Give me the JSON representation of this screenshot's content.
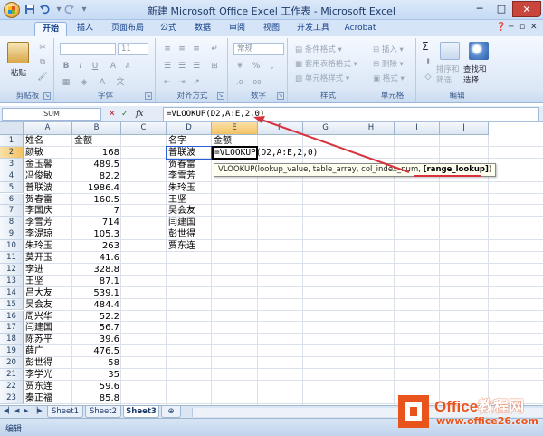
{
  "colors": {
    "accent": "#15428b",
    "selection": "#f3c363",
    "annotation": "#d9323e",
    "watermark": "#e8541c"
  },
  "window": {
    "title": "新建 Microsoft Office Excel 工作表 - Microsoft Excel",
    "controls": {
      "minimize": "─",
      "maximize": "□",
      "close": "✕"
    },
    "qat": {
      "save_icon": "save-icon",
      "undo_icon": "undo-icon",
      "redo_icon": "redo-icon"
    }
  },
  "ribbon": {
    "tabs": [
      "开始",
      "插入",
      "页面布局",
      "公式",
      "数据",
      "审阅",
      "视图",
      "开发工具",
      "Acrobat"
    ],
    "active_tab": "开始",
    "groups": {
      "clipboard": {
        "label": "剪贴板",
        "paste": "粘贴"
      },
      "font": {
        "label": "字体",
        "size": "11",
        "bold": "B",
        "italic": "I",
        "underline": "U"
      },
      "alignment": {
        "label": "对齐方式"
      },
      "number": {
        "label": "数字",
        "format": "常规"
      },
      "styles": {
        "label": "样式",
        "items": [
          "条件格式",
          "套用表格格式",
          "单元格样式"
        ]
      },
      "cells": {
        "label": "单元格",
        "items": [
          "插入",
          "删除",
          "格式"
        ]
      },
      "editing": {
        "label": "编辑",
        "sum": "Σ",
        "sort": "排序和\n筛选",
        "sort_l1": "排序和",
        "sort_l2": "筛选",
        "find_l1": "查找和",
        "find_l2": "选择"
      }
    }
  },
  "formula_bar": {
    "name_box": "SUM",
    "cancel": "✕",
    "enter": "✓",
    "fx": "fx",
    "formula": "=VLOOKUP(D2,A:E,2,0)"
  },
  "grid": {
    "columns": [
      "A",
      "B",
      "C",
      "D",
      "E",
      "F",
      "G",
      "H",
      "I",
      "J"
    ],
    "rows": [
      "1",
      "2",
      "3",
      "4",
      "5",
      "6",
      "7",
      "8",
      "9",
      "10",
      "11",
      "12",
      "13",
      "14",
      "15",
      "16",
      "17",
      "18",
      "19",
      "20",
      "21",
      "22",
      "23"
    ],
    "col_a": [
      "姓名",
      "颜敏",
      "金玉馨",
      "冯俊敏",
      "普联波",
      "贺春雷",
      "李国庆",
      "李雪芳",
      "李湜琼",
      "朱玲玉",
      "莫开玉",
      "李进",
      "王坚",
      "吕大友",
      "吴会友",
      "周兴华",
      "闫建国",
      "陈苏平",
      "薛广",
      "彭世得",
      "李学光",
      "贾东连",
      "秦正福"
    ],
    "col_b": [
      "金额",
      "168",
      "489.5",
      "82.2",
      "1986.4",
      "160.5",
      "7",
      "714",
      "105.3",
      "263",
      "41.6",
      "328.8",
      "87.1",
      "539.1",
      "484.4",
      "52.2",
      "56.7",
      "39.6",
      "476.5",
      "58",
      "35",
      "59.6",
      "85.8"
    ],
    "col_d": [
      "名字",
      "普联波",
      "贺春雷",
      "李雪芳",
      "朱玲玉",
      "王坚",
      "吴会友",
      "闫建国",
      "彭世得",
      "贾东连"
    ],
    "e1": "金额",
    "e2_formula": "=VLOOKUP(D2,A:E,2,0)",
    "tooltip": {
      "args": "VLOOKUP(lookup_value, table_array, col_index_num, ",
      "optional": "[range_lookup]",
      "close": ")"
    }
  },
  "sheets": [
    "Sheet1",
    "Sheet2",
    "Sheet3"
  ],
  "active_sheet": "Sheet3",
  "status": "编辑",
  "watermark": {
    "line1_a": "Office",
    "line1_b": "教程网",
    "line2": "www.office26.com"
  }
}
